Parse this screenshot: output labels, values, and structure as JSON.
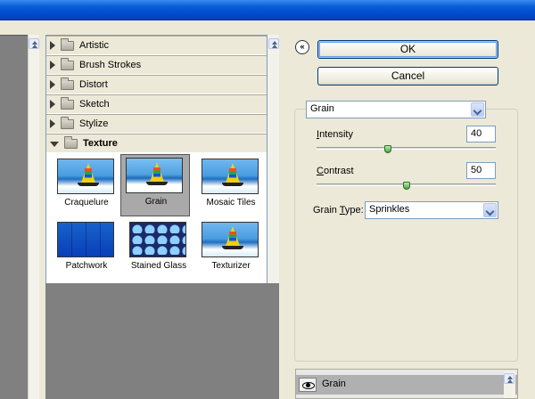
{
  "dialog": {
    "ok_label": "OK",
    "cancel_label": "Cancel",
    "collapse_glyph": "«"
  },
  "gallery": {
    "categories": [
      {
        "label": "Artistic",
        "state": "collapsed"
      },
      {
        "label": "Brush Strokes",
        "state": "collapsed"
      },
      {
        "label": "Distort",
        "state": "collapsed"
      },
      {
        "label": "Sketch",
        "state": "collapsed"
      },
      {
        "label": "Stylize",
        "state": "collapsed"
      },
      {
        "label": "Texture",
        "state": "expanded"
      }
    ],
    "texture_filters": [
      {
        "label": "Craquelure",
        "selected": false
      },
      {
        "label": "Grain",
        "selected": true
      },
      {
        "label": "Mosaic Tiles",
        "selected": false
      },
      {
        "label": "Patchwork",
        "selected": false
      },
      {
        "label": "Stained Glass",
        "selected": false
      },
      {
        "label": "Texturizer",
        "selected": false
      }
    ]
  },
  "settings": {
    "filter_select": "Grain",
    "intensity": {
      "label_first": "I",
      "label_rest": "ntensity",
      "value": "40",
      "range_max": 100,
      "level": 40
    },
    "contrast": {
      "label_first": "C",
      "label_rest": "ontrast",
      "value": "50",
      "range_max": 100,
      "level": 50
    },
    "grain_type": {
      "label_pre": "Grain ",
      "label_underlined": "T",
      "label_post": "ype:",
      "value": "Sprinkles"
    }
  },
  "layers": {
    "items": [
      {
        "name": "Grain",
        "visible": true
      }
    ]
  },
  "colors": {
    "titlebar": "#0048cf",
    "preview_gray": "#808080",
    "selected_thumb": "#a9a9a9",
    "slider_knob": "#4aa53e"
  }
}
